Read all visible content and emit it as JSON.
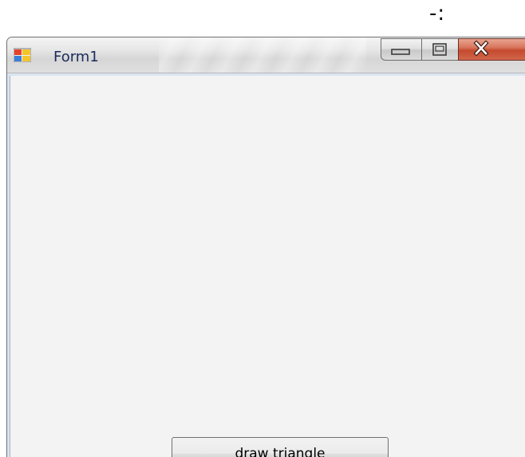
{
  "caption": "-:",
  "window": {
    "title": "Form1",
    "app_icon": "windows-form-icon",
    "controls": {
      "minimize_icon": "minimize-icon",
      "maximize_icon": "maximize-icon",
      "close_icon": "close-icon"
    }
  },
  "form": {
    "button_label": "draw triangle"
  },
  "colors": {
    "client_background": "#f3f3f3",
    "title_text": "#1b2a5c",
    "close_button": "#c44a2e"
  }
}
